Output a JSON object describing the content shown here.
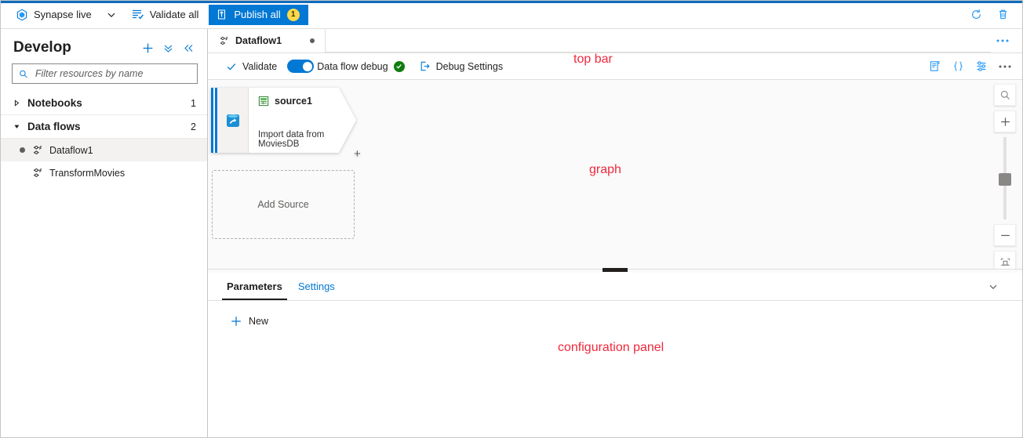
{
  "topbar": {
    "workspace_label": "Synapse live",
    "workspace_chevron_icon": "chevron-down-icon",
    "validate_all_label": "Validate all",
    "validate_all_icon": "validate-list-icon",
    "publish_all_label": "Publish all",
    "publish_all_icon": "publish-upload-icon",
    "publish_all_badge": "1",
    "refresh_icon": "refresh-icon",
    "delete_icon": "trash-icon",
    "accent_color": "#0078d4",
    "rail_color": "#0f6cbd",
    "badge_color": "#ffd94a"
  },
  "sidebar": {
    "title": "Develop",
    "actions": [
      {
        "name": "add-new-resource-button",
        "icon": "plus-icon"
      },
      {
        "name": "more-actions-button",
        "icon": "double-chevron-down-icon"
      },
      {
        "name": "collapse-panel-button",
        "icon": "double-chevron-left-icon"
      }
    ],
    "filter": {
      "placeholder": "Filter resources by name",
      "value": "",
      "icon": "search-icon"
    },
    "groups": [
      {
        "label": "Notebooks",
        "count": "1",
        "expanded": false,
        "twisty_icon": "triangle-right-icon"
      },
      {
        "label": "Data flows",
        "count": "2",
        "expanded": true,
        "twisty_icon": "triangle-down-icon"
      }
    ],
    "items": [
      {
        "label": "Dataflow1",
        "icon": "dataflow-icon",
        "selected": true,
        "modified": true
      },
      {
        "label": "TransformMovies",
        "icon": "dataflow-icon",
        "selected": false,
        "modified": false
      }
    ]
  },
  "tabstrip": {
    "tabs": [
      {
        "label": "Dataflow1",
        "icon": "dataflow-icon",
        "dirty": true,
        "active": true
      }
    ],
    "more_icon": "ellipsis-icon"
  },
  "commandbar": {
    "validate_label": "Validate",
    "validate_icon": "checkmark-icon",
    "debug_toggle_label": "Data flow debug",
    "debug_toggle_on": true,
    "debug_status_icon": "success-check-icon",
    "debug_settings_label": "Debug Settings",
    "debug_settings_icon": "debug-settings-icon",
    "right_icons": [
      {
        "name": "data-flow-script-button",
        "icon": "script-icon"
      },
      {
        "name": "code-button",
        "icon": "curly-braces-icon"
      },
      {
        "name": "flow-settings-button",
        "icon": "sliders-icon"
      },
      {
        "name": "more-commands-button",
        "icon": "ellipsis-icon"
      }
    ]
  },
  "graph": {
    "node": {
      "title": "source1",
      "icon": "dataset-table-icon",
      "source_icon": "database-source-icon",
      "subtitle": "Import data from MoviesDB",
      "add_stream_icon": "plus-icon",
      "accent_color": "#0078d4"
    },
    "add_source_label": "Add Source",
    "zoom_controls": [
      {
        "name": "zoom-search-button",
        "icon": "magnifier-icon"
      },
      {
        "name": "zoom-in-button",
        "icon": "plus-icon"
      },
      {
        "name": "zoom-slider",
        "icon": "slider-handle"
      },
      {
        "name": "zoom-out-button",
        "icon": "minus-icon"
      },
      {
        "name": "fit-to-screen-button",
        "icon": "fit-screen-icon"
      }
    ]
  },
  "config": {
    "tabs": [
      {
        "label": "Parameters",
        "active": true
      },
      {
        "label": "Settings",
        "active": false
      }
    ],
    "collapse_icon": "chevron-down-icon",
    "new_label": "New",
    "new_icon": "plus-icon"
  },
  "annotations": [
    {
      "id": "anno-topbar",
      "text": "top bar",
      "color": "#f0283c"
    },
    {
      "id": "anno-graph",
      "text": "graph",
      "color": "#f0283c"
    },
    {
      "id": "anno-config",
      "text": "configuration panel",
      "color": "#f0283c"
    }
  ]
}
